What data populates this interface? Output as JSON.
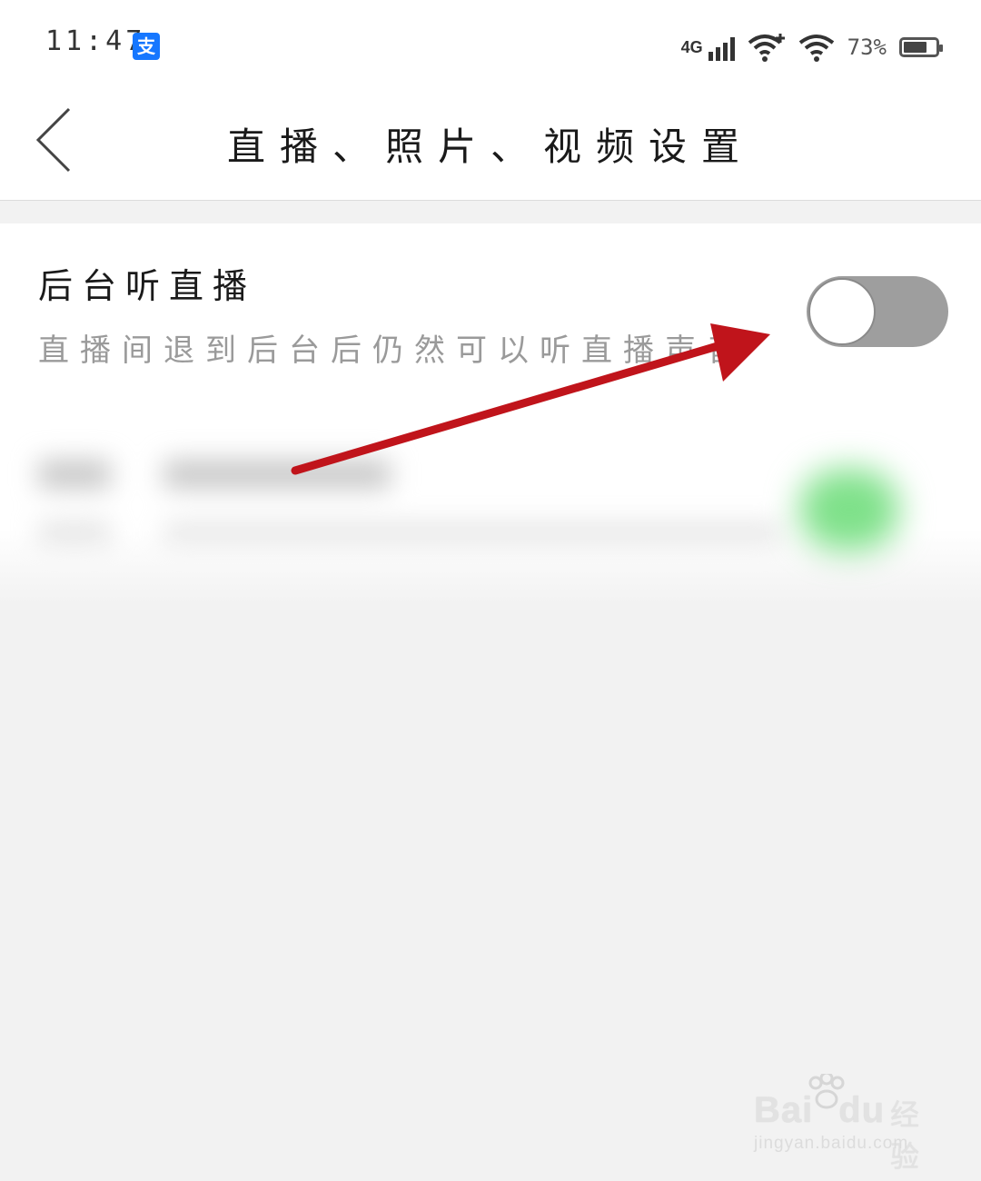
{
  "status_bar": {
    "time": "11:47",
    "app_badge": "支",
    "network_label": "4G",
    "battery_percent": "73%",
    "battery_level": 0.73,
    "icons": [
      "alipay-icon",
      "signal-icon",
      "wifi-plus-icon",
      "wifi-icon",
      "battery-icon"
    ]
  },
  "header": {
    "title": "直播、照片、视频设置",
    "back_icon": "chevron-left-icon"
  },
  "settings": [
    {
      "title": "后台听直播",
      "description": "直播间退到后台后仍然可以听直播声音",
      "enabled": false
    }
  ],
  "annotation": {
    "arrow_color": "#c0141b"
  },
  "watermark": {
    "brand": "Bai",
    "brand_suffix": "du",
    "cn": "经验",
    "url": "jingyan.baidu.com"
  },
  "colors": {
    "toggle_off": "#9e9e9e",
    "toggle_on_blurred": "#7fe18a",
    "alipay_blue": "#1677ff"
  }
}
